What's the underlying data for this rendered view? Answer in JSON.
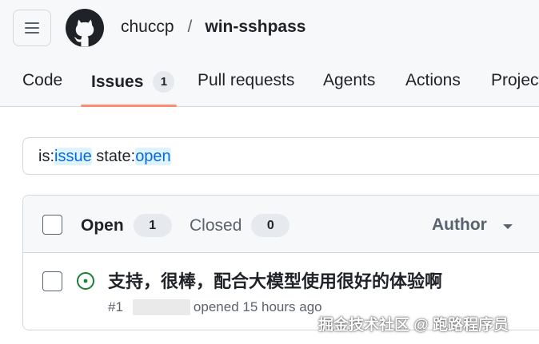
{
  "header": {
    "owner": "chuccp",
    "separator": "/",
    "repo": "win-sshpass",
    "menu_icon": "hamburger-icon",
    "logo_icon": "github-mark-icon"
  },
  "tabs": [
    {
      "label": "Code"
    },
    {
      "label": "Issues",
      "count": "1"
    },
    {
      "label": "Pull requests"
    },
    {
      "label": "Agents"
    },
    {
      "label": "Actions"
    },
    {
      "label": "Project"
    }
  ],
  "search": {
    "k1": "is:",
    "v1": "issue",
    "k2": " state:",
    "v2": "open"
  },
  "list": {
    "open_label": "Open",
    "open_count": "1",
    "closed_label": "Closed",
    "closed_count": "0",
    "author_label": "Author"
  },
  "issue": {
    "title": "支持，很棒，配合大模型使用很好的体验啊",
    "number": "#1",
    "meta": "opened 15 hours ago",
    "status_icon": "issue-open-icon"
  },
  "watermark": "掘金技术社区 @ 跑路程序员",
  "colors": {
    "accent": "#fd8c73",
    "link": "#0969da",
    "open_green": "#1a7f37",
    "header_bg": "#f6f8fa"
  }
}
